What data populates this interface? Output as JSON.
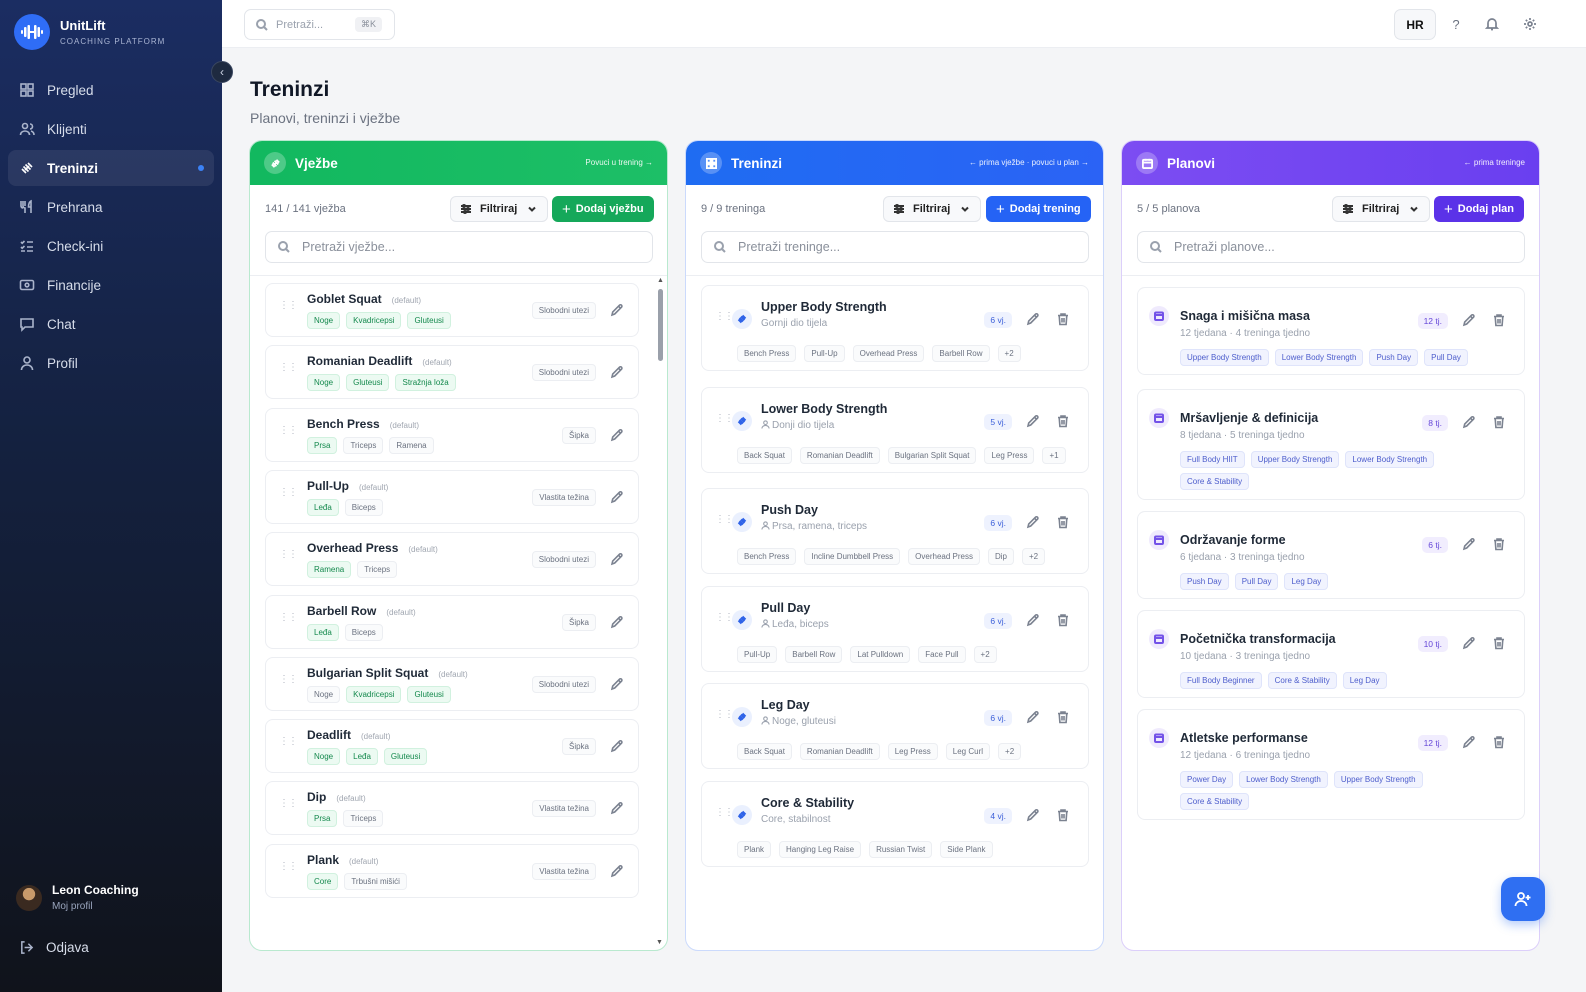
{
  "app": {
    "name": "UnitLift",
    "subtitle": "COACHING PLATFORM",
    "collapse_glyph": "‹"
  },
  "sidebar": {
    "items": [
      {
        "label": "Pregled",
        "icon": "grid-icon"
      },
      {
        "label": "Klijenti",
        "icon": "users-icon"
      },
      {
        "label": "Treninzi",
        "icon": "dumbbell-icon",
        "active": true
      },
      {
        "label": "Prehrana",
        "icon": "utensils-icon"
      },
      {
        "label": "Check-ini",
        "icon": "checklist-icon"
      },
      {
        "label": "Financije",
        "icon": "wallet-icon"
      },
      {
        "label": "Chat",
        "icon": "chat-icon"
      },
      {
        "label": "Profil",
        "icon": "user-icon"
      }
    ],
    "user": {
      "name": "Leon Coaching",
      "sub": "Moj profil"
    },
    "logout": "Odjava"
  },
  "topbar": {
    "search_placeholder": "Pretraži...",
    "shortcut": "⌘K",
    "language": "HR",
    "help": "?"
  },
  "page": {
    "title": "Treninzi",
    "subtitle": "Planovi, treninzi i vježbe"
  },
  "colors": {
    "green": "#16b862",
    "blue": "#2563f5",
    "purple": "#6d3ff0"
  },
  "exercises_col": {
    "title": "Vježbe",
    "hint": "Povuci u trening →",
    "count": "141 / 141 vježba",
    "filter": "Filtriraj",
    "add": "Dodaj vježbu",
    "search_placeholder": "Pretraži vježbe...",
    "items": [
      {
        "name": "Goblet Squat",
        "def": "(default)",
        "equip": "Slobodni utezi",
        "tags": [
          "Noge",
          "Kvadricepsi",
          "Gluteusi"
        ],
        "tagc": [
          "g",
          "g",
          "g"
        ]
      },
      {
        "name": "Romanian Deadlift",
        "def": "(default)",
        "equip": "Slobodni utezi",
        "tags": [
          "Noge",
          "Gluteusi",
          "Stražnja loža"
        ],
        "tagc": [
          "g",
          "g",
          "g"
        ]
      },
      {
        "name": "Bench Press",
        "def": "(default)",
        "equip": "Šipka",
        "tags": [
          "Prsa",
          "Triceps",
          "Ramena"
        ],
        "tagc": [
          "g",
          "n",
          "n"
        ]
      },
      {
        "name": "Pull-Up",
        "def": "(default)",
        "equip": "Vlastita težina",
        "tags": [
          "Leđa",
          "Biceps"
        ],
        "tagc": [
          "g",
          "n"
        ]
      },
      {
        "name": "Overhead Press",
        "def": "(default)",
        "equip": "Slobodni utezi",
        "tags": [
          "Ramena",
          "Triceps"
        ],
        "tagc": [
          "g",
          "n"
        ]
      },
      {
        "name": "Barbell Row",
        "def": "(default)",
        "equip": "Šipka",
        "tags": [
          "Leđa",
          "Biceps"
        ],
        "tagc": [
          "g",
          "n"
        ]
      },
      {
        "name": "Bulgarian Split Squat",
        "def": "(default)",
        "equip": "Slobodni utezi",
        "tags": [
          "Noge",
          "Kvadricepsi",
          "Gluteusi"
        ],
        "tagc": [
          "n",
          "g",
          "g"
        ]
      },
      {
        "name": "Deadlift",
        "def": "(default)",
        "equip": "Šipka",
        "tags": [
          "Noge",
          "Leđa",
          "Gluteusi"
        ],
        "tagc": [
          "g",
          "g",
          "g"
        ]
      },
      {
        "name": "Dip",
        "def": "(default)",
        "equip": "Vlastita težina",
        "tags": [
          "Prsa",
          "Triceps"
        ],
        "tagc": [
          "g",
          "n"
        ]
      },
      {
        "name": "Plank",
        "def": "(default)",
        "equip": "Vlastita težina",
        "tags": [
          "Core",
          "Trbušni mišići"
        ],
        "tagc": [
          "g",
          "n"
        ]
      }
    ]
  },
  "workouts_col": {
    "title": "Treninzi",
    "hint": "← prima vježbe · povuci u plan →",
    "count": "9 / 9 treninga",
    "filter": "Filtriraj",
    "add": "Dodaj trening",
    "search_placeholder": "Pretraži treninge...",
    "items": [
      {
        "name": "Upper Body Strength",
        "sub": "Gornji dio tijela",
        "badge": "6 vj.",
        "person": false,
        "tags": [
          "Bench Press",
          "Pull-Up",
          "Overhead Press",
          "Barbell Row",
          "+2"
        ]
      },
      {
        "name": "Lower Body Strength",
        "sub": "Donji dio tijela",
        "badge": "5 vj.",
        "person": true,
        "tags": [
          "Back Squat",
          "Romanian Deadlift",
          "Bulgarian Split Squat",
          "Leg Press",
          "+1"
        ]
      },
      {
        "name": "Push Day",
        "sub": "Prsa, ramena, triceps",
        "badge": "6 vj.",
        "person": true,
        "tags": [
          "Bench Press",
          "Incline Dumbbell Press",
          "Overhead Press",
          "Dip",
          "+2"
        ]
      },
      {
        "name": "Pull Day",
        "sub": "Leđa, biceps",
        "badge": "6 vj.",
        "person": true,
        "tags": [
          "Pull-Up",
          "Barbell Row",
          "Lat Pulldown",
          "Face Pull",
          "+2"
        ]
      },
      {
        "name": "Leg Day",
        "sub": "Noge, gluteusi",
        "badge": "6 vj.",
        "person": true,
        "tags": [
          "Back Squat",
          "Romanian Deadlift",
          "Leg Press",
          "Leg Curl",
          "+2"
        ]
      },
      {
        "name": "Core & Stability",
        "sub": "Core, stabilnost",
        "badge": "4 vj.",
        "person": false,
        "tags": [
          "Plank",
          "Hanging Leg Raise",
          "Russian Twist",
          "Side Plank"
        ]
      }
    ]
  },
  "plans_col": {
    "title": "Planovi",
    "hint": "← prima treninge",
    "count": "5 / 5 planova",
    "filter": "Filtriraj",
    "add": "Dodaj plan",
    "search_placeholder": "Pretraži planove...",
    "items": [
      {
        "name": "Snaga i mišična masa",
        "weeks": "12 tjedana",
        "freq": "4 treninga tjedno",
        "badge": "12 tj.",
        "tags": [
          "Upper Body Strength",
          "Lower Body Strength",
          "Push Day",
          "Pull Day"
        ],
        "tags2": []
      },
      {
        "name": "Mršavljenje & definicija",
        "weeks": "8 tjedana",
        "freq": "5 treninga tjedno",
        "badge": "8 tj.",
        "tags": [
          "Full Body HIIT",
          "Upper Body Strength",
          "Lower Body Strength"
        ],
        "tags2": [
          "Core & Stability"
        ]
      },
      {
        "name": "Održavanje forme",
        "weeks": "6 tjedana",
        "freq": "3 treninga tjedno",
        "badge": "6 tj.",
        "tags": [
          "Push Day",
          "Pull Day",
          "Leg Day"
        ],
        "tags2": []
      },
      {
        "name": "Početnička transformacija",
        "weeks": "10 tjedana",
        "freq": "3 treninga tjedno",
        "badge": "10 tj.",
        "tags": [
          "Full Body Beginner",
          "Core & Stability",
          "Leg Day"
        ],
        "tags2": []
      },
      {
        "name": "Atletske performanse",
        "weeks": "12 tjedana",
        "freq": "6 treninga tjedno",
        "badge": "12 tj.",
        "tags": [
          "Power Day",
          "Lower Body Strength",
          "Upper Body Strength"
        ],
        "tags2": [
          "Core & Stability"
        ]
      }
    ]
  }
}
